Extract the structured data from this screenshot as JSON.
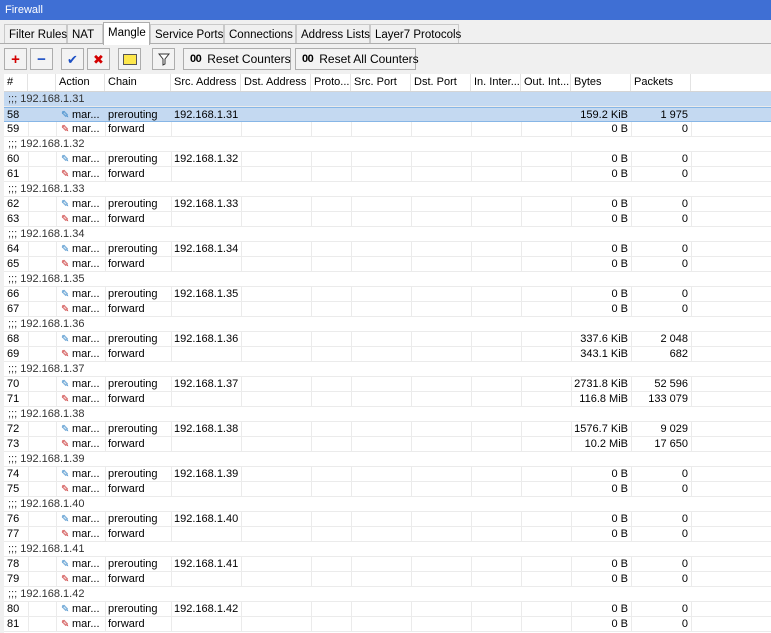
{
  "window": {
    "title": "Firewall"
  },
  "tabs": [
    "Filter Rules",
    "NAT",
    "Mangle",
    "Service Ports",
    "Connections",
    "Address Lists",
    "Layer7 Protocols"
  ],
  "toolbar": {
    "reset_counters": "Reset Counters",
    "reset_all_counters": "Reset All Counters",
    "counter_prefix": "00"
  },
  "columns": [
    "#",
    "Action",
    "Chain",
    "Src. Address",
    "Dst. Address",
    "Proto...",
    "Src. Port",
    "Dst. Port",
    "In. Inter...",
    "Out. Int...",
    "Bytes",
    "Packets"
  ],
  "icons": {
    "add": "plus-icon",
    "remove": "minus-icon",
    "enable": "check-icon",
    "disable": "x-icon",
    "comment": "note-icon",
    "filter": "funnel-icon",
    "action_pre": "pencil-icon",
    "action_fwd": "pencil-red-icon"
  },
  "colors": {
    "title_bar": "#3f6fd4",
    "selection": "#c4d9f1",
    "add": "#d40000",
    "enable": "#1c4fc4"
  },
  "groups": [
    {
      "comment": ";;; 192.168.1.31",
      "rows": [
        {
          "num": "58",
          "action": "mar...",
          "chain": "prerouting",
          "src": "192.168.1.31",
          "bytes": "159.2 KiB",
          "packets": "1 975",
          "selected": true
        },
        {
          "num": "59",
          "action": "mar...",
          "chain": "forward",
          "src": "",
          "bytes": "0 B",
          "packets": "0"
        }
      ]
    },
    {
      "comment": ";;; 192.168.1.32",
      "rows": [
        {
          "num": "60",
          "action": "mar...",
          "chain": "prerouting",
          "src": "192.168.1.32",
          "bytes": "0 B",
          "packets": "0"
        },
        {
          "num": "61",
          "action": "mar...",
          "chain": "forward",
          "src": "",
          "bytes": "0 B",
          "packets": "0"
        }
      ]
    },
    {
      "comment": ";;; 192.168.1.33",
      "rows": [
        {
          "num": "62",
          "action": "mar...",
          "chain": "prerouting",
          "src": "192.168.1.33",
          "bytes": "0 B",
          "packets": "0"
        },
        {
          "num": "63",
          "action": "mar...",
          "chain": "forward",
          "src": "",
          "bytes": "0 B",
          "packets": "0"
        }
      ]
    },
    {
      "comment": ";;; 192.168.1.34",
      "rows": [
        {
          "num": "64",
          "action": "mar...",
          "chain": "prerouting",
          "src": "192.168.1.34",
          "bytes": "0 B",
          "packets": "0"
        },
        {
          "num": "65",
          "action": "mar...",
          "chain": "forward",
          "src": "",
          "bytes": "0 B",
          "packets": "0"
        }
      ]
    },
    {
      "comment": ";;; 192.168.1.35",
      "rows": [
        {
          "num": "66",
          "action": "mar...",
          "chain": "prerouting",
          "src": "192.168.1.35",
          "bytes": "0 B",
          "packets": "0"
        },
        {
          "num": "67",
          "action": "mar...",
          "chain": "forward",
          "src": "",
          "bytes": "0 B",
          "packets": "0"
        }
      ]
    },
    {
      "comment": ";;; 192.168.1.36",
      "rows": [
        {
          "num": "68",
          "action": "mar...",
          "chain": "prerouting",
          "src": "192.168.1.36",
          "bytes": "337.6 KiB",
          "packets": "2 048"
        },
        {
          "num": "69",
          "action": "mar...",
          "chain": "forward",
          "src": "",
          "bytes": "343.1 KiB",
          "packets": "682"
        }
      ]
    },
    {
      "comment": ";;; 192.168.1.37",
      "rows": [
        {
          "num": "70",
          "action": "mar...",
          "chain": "prerouting",
          "src": "192.168.1.37",
          "bytes": "2731.8 KiB",
          "packets": "52 596"
        },
        {
          "num": "71",
          "action": "mar...",
          "chain": "forward",
          "src": "",
          "bytes": "116.8 MiB",
          "packets": "133 079"
        }
      ]
    },
    {
      "comment": ";;; 192.168.1.38",
      "rows": [
        {
          "num": "72",
          "action": "mar...",
          "chain": "prerouting",
          "src": "192.168.1.38",
          "bytes": "1576.7 KiB",
          "packets": "9 029"
        },
        {
          "num": "73",
          "action": "mar...",
          "chain": "forward",
          "src": "",
          "bytes": "10.2 MiB",
          "packets": "17 650"
        }
      ]
    },
    {
      "comment": ";;; 192.168.1.39",
      "rows": [
        {
          "num": "74",
          "action": "mar...",
          "chain": "prerouting",
          "src": "192.168.1.39",
          "bytes": "0 B",
          "packets": "0"
        },
        {
          "num": "75",
          "action": "mar...",
          "chain": "forward",
          "src": "",
          "bytes": "0 B",
          "packets": "0"
        }
      ]
    },
    {
      "comment": ";;; 192.168.1.40",
      "rows": [
        {
          "num": "76",
          "action": "mar...",
          "chain": "prerouting",
          "src": "192.168.1.40",
          "bytes": "0 B",
          "packets": "0"
        },
        {
          "num": "77",
          "action": "mar...",
          "chain": "forward",
          "src": "",
          "bytes": "0 B",
          "packets": "0"
        }
      ]
    },
    {
      "comment": ";;; 192.168.1.41",
      "rows": [
        {
          "num": "78",
          "action": "mar...",
          "chain": "prerouting",
          "src": "192.168.1.41",
          "bytes": "0 B",
          "packets": "0"
        },
        {
          "num": "79",
          "action": "mar...",
          "chain": "forward",
          "src": "",
          "bytes": "0 B",
          "packets": "0"
        }
      ]
    },
    {
      "comment": ";;; 192.168.1.42",
      "rows": [
        {
          "num": "80",
          "action": "mar...",
          "chain": "prerouting",
          "src": "192.168.1.42",
          "bytes": "0 B",
          "packets": "0"
        },
        {
          "num": "81",
          "action": "mar...",
          "chain": "forward",
          "src": "",
          "bytes": "0 B",
          "packets": "0"
        }
      ]
    }
  ]
}
